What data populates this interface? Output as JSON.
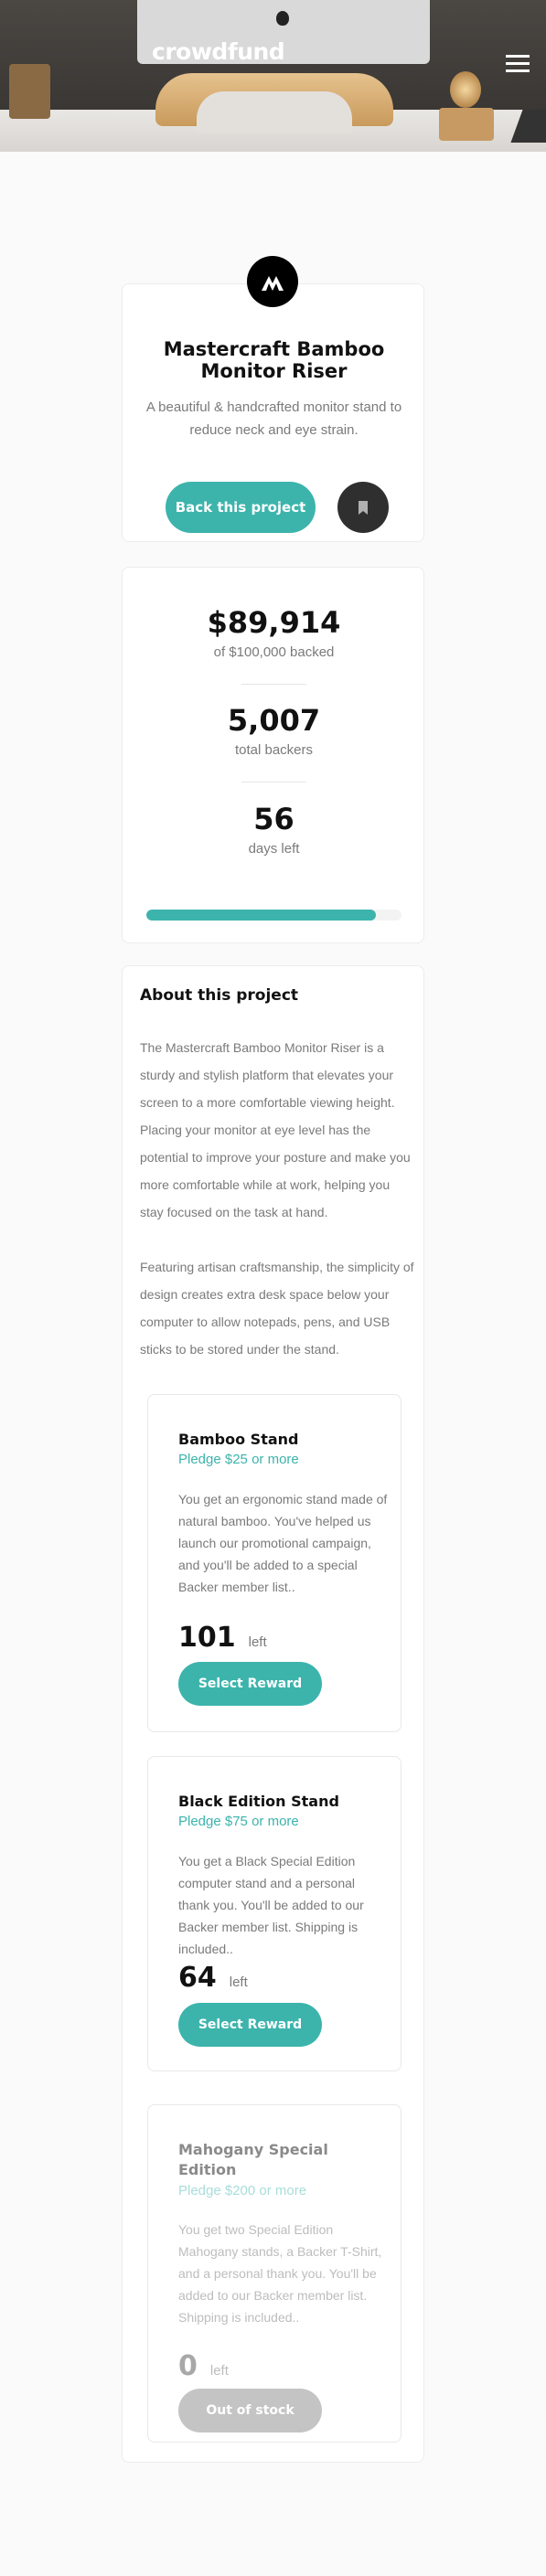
{
  "header": {
    "logo": "crowdfund",
    "menu_icon": "hamburger-icon"
  },
  "project": {
    "title": "Mastercraft Bamboo Monitor Riser",
    "subtitle": "A beautiful & handcrafted monitor stand to reduce neck and eye strain.",
    "back_label": "Back this project",
    "bookmark_icon": "bookmark-icon"
  },
  "stats": {
    "amount": "$89,914",
    "amount_label": "of $100,000 backed",
    "backers": "5,007",
    "backers_label": "total backers",
    "days": "56",
    "days_label": "days left",
    "progress_fraction": 0.899
  },
  "about": {
    "heading": "About this project",
    "paragraphs": [
      "The Mastercraft Bamboo Monitor Riser is a sturdy and stylish platform that elevates your screen to a more comfortable viewing height. Placing your monitor at eye level has the potential to improve your posture and make you more comfortable while at work, helping you stay focused on the task at hand.",
      "Featuring artisan craftsmanship, the simplicity of design creates extra desk space below your computer to allow notepads, pens, and USB sticks to be stored under the stand."
    ]
  },
  "rewards": [
    {
      "name": "Bamboo Stand",
      "pledge": "Pledge $25 or more",
      "description": "You get an ergonomic stand made of natural bamboo. You've helped us launch our promotional campaign, and you'll be added to a special Backer member list..",
      "left_count": "101",
      "left_label": "left",
      "button": "Select Reward"
    },
    {
      "name": "Black Edition Stand",
      "pledge": "Pledge $75 or more",
      "description": "You get a Black Special Edition computer stand and a personal thank you. You'll be added to our Backer member list. Shipping is included..",
      "left_count": "64",
      "left_label": "left",
      "button": "Select Reward"
    },
    {
      "name": "Mahogany Special Edition",
      "pledge": "Pledge $200 or more",
      "description": "You get two Special Edition Mahogany stands, a Backer T-Shirt, and a personal thank you. You'll be added to our Backer member list. Shipping is included..",
      "left_count": "0",
      "left_label": "left",
      "button": "Out of stock"
    }
  ],
  "colors": {
    "accent": "#3cb4ac",
    "dark": "#2f2f2f",
    "muted": "#7a7a7a"
  }
}
